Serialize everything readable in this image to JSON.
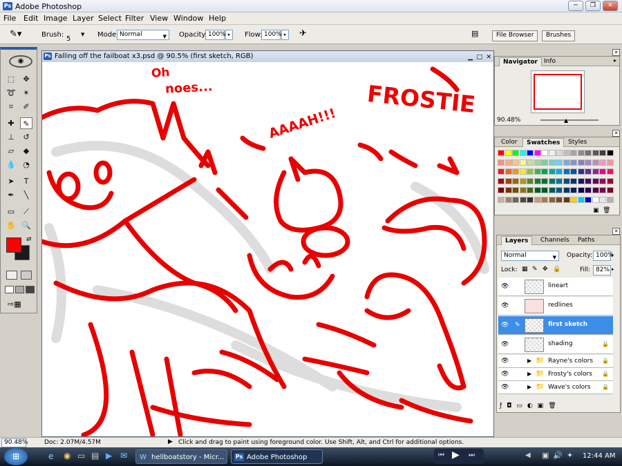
{
  "app": {
    "title": "Adobe Photoshop"
  },
  "menu": [
    "File",
    "Edit",
    "Image",
    "Layer",
    "Select",
    "Filter",
    "View",
    "Window",
    "Help"
  ],
  "options": {
    "brush_label": "Brush:",
    "brush_size": "5",
    "mode_label": "Mode:",
    "mode_value": "Normal",
    "opacity_label": "Opacity:",
    "opacity_value": "100%",
    "flow_label": "Flow:",
    "flow_value": "100%"
  },
  "wells": {
    "file_browser": "File Browser",
    "brushes": "Brushes"
  },
  "document": {
    "title": "Falling off the failboat x3.psd @ 90.5% (first sketch, RGB)"
  },
  "canvas_text": {
    "oh": "Oh",
    "noes": "noes...",
    "aaah": "AAAAH!!!",
    "frostie": "FROSTIE"
  },
  "navigator": {
    "tabs": [
      "Navigator",
      "Info"
    ],
    "zoom": "90.48%"
  },
  "swatches": {
    "tabs": [
      "Color",
      "Swatches",
      "Styles"
    ],
    "colors": [
      "#ff0000",
      "#ffff00",
      "#00ff00",
      "#00ffff",
      "#0000ff",
      "#ff00ff",
      "#ffffff",
      "#f0f0f0",
      "#d9d9d9",
      "#c0c0c0",
      "#a6a6a6",
      "#8c8c8c",
      "#737373",
      "#595959",
      "#3f3f3f",
      "#000000",
      "#f5917f",
      "#f9ad81",
      "#fdc68a",
      "#fff79a",
      "#c4df9b",
      "#a3d39c",
      "#82ca9d",
      "#7bcdc8",
      "#6ecff6",
      "#7ea7d8",
      "#8493ca",
      "#8882be",
      "#a187be",
      "#bc8dbf",
      "#f49ac2",
      "#f6989d",
      "#ed1c24",
      "#f26522",
      "#f7941d",
      "#fff200",
      "#8dc63f",
      "#39b54a",
      "#00a651",
      "#00a99d",
      "#00aeef",
      "#0072bc",
      "#0054a6",
      "#2e3192",
      "#662d91",
      "#92278f",
      "#ec008c",
      "#ed145b",
      "#9e0b0f",
      "#a0410d",
      "#a36209",
      "#aba000",
      "#598527",
      "#1a7b30",
      "#007236",
      "#00746b",
      "#0076a3",
      "#004b80",
      "#003471",
      "#1b1464",
      "#440e62",
      "#630460",
      "#9e005d",
      "#9e0039",
      "#790000",
      "#7b2e00",
      "#7d4900",
      "#827b00",
      "#406618",
      "#005e20",
      "#005826",
      "#005952",
      "#005b7f",
      "#003663",
      "#002157",
      "#0d004c",
      "#32004b",
      "#4b0049",
      "#7b0046",
      "#7a0026",
      "#c7b299",
      "#998675",
      "#736357",
      "#534741",
      "#37302d",
      "#c69c6d",
      "#a67c52",
      "#8c6239",
      "#754c24",
      "#603913",
      "#ffcc00",
      "#00ccff",
      "#0000cc",
      "#ffffff",
      "#e6e6e6",
      "#b3b3b3"
    ]
  },
  "layers": {
    "tabs": [
      "Layers",
      "Channels",
      "Paths"
    ],
    "blend": "Normal",
    "opacity_label": "Opacity:",
    "opacity_value": "100%",
    "lock_label": "Lock:",
    "fill_label": "Fill:",
    "fill_value": "82%",
    "items": [
      "lineart",
      "redlines",
      "first sketch",
      "shading"
    ],
    "groups": [
      "Rayne's colors",
      "Frosty's colors",
      "Wave's colors"
    ]
  },
  "status": {
    "zoom": "90.48%",
    "doc": "Doc: 2.07M/4.57M",
    "hint": "Click and drag to paint using foreground color.  Use Shift, Alt, and Ctrl for additional options."
  },
  "taskbar": {
    "tasks": [
      "hellboatstory - Micr...",
      "Adobe Photoshop"
    ],
    "clock": "12:44 AM"
  },
  "colors": {
    "foreground": "#ff0000",
    "background": "#1a1a1a",
    "sketch": "#e80000"
  }
}
